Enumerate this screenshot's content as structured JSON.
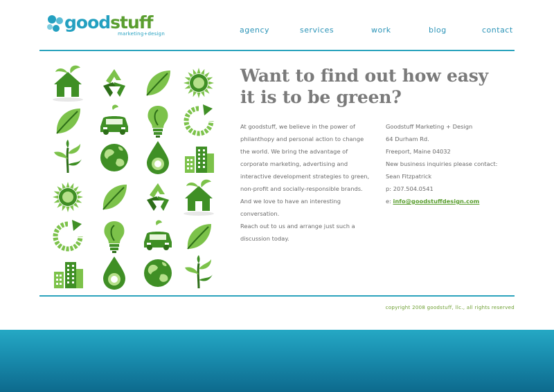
{
  "logo": {
    "word_a": "good",
    "word_b": "stuff",
    "tagline": "marketing+design"
  },
  "nav": [
    "agency",
    "services",
    "work",
    "blog",
    "contact"
  ],
  "icons": [
    "house-icon",
    "recycle-icon",
    "leaf-icon",
    "sun-icon",
    "leaf-icon",
    "car-icon",
    "lightbulb-icon",
    "refresh-arrow-icon",
    "sapling-icon",
    "globe-icon",
    "water-drop-icon",
    "buildings-icon",
    "sun-icon",
    "leaf-icon",
    "recycle-icon",
    "house-icon",
    "refresh-arrow-icon",
    "lightbulb-icon",
    "car-icon",
    "leaf-icon",
    "buildings-icon",
    "water-drop-icon",
    "globe-icon",
    "sapling-icon"
  ],
  "headline": {
    "line1": "Want to find out how easy",
    "line2": "it is to be green?"
  },
  "intro": [
    "At goodstuff, we believe in the power of",
    "philanthopy and personal action to change",
    "the world. We bring the advantage of",
    "corporate marketing, advertising and",
    "interactive development strategies to green,",
    "non-profit and socially-responsible brands.",
    "And we love to have an interesting",
    "conversation.",
    "Reach out to us and arrange just such a",
    "discussion today."
  ],
  "contact": {
    "company": "Goodstuff Marketing + Design",
    "street": "64 Durham Rd.",
    "city": "Freeport, Maine 04032",
    "inquiries": "New business inquiries please contact:",
    "name": "Sean Fitzpatrick",
    "phone": "p: 207.504.0541",
    "email_prefix": "e:",
    "email": "info@goodstuffdesign.com"
  },
  "copyright": "copyright 2008 goodstuff, llc., all rights reserved",
  "colors": {
    "brand_blue": "#23a0c0",
    "brand_green": "#5a9e2f",
    "footer_band": "#1a8fb0"
  }
}
